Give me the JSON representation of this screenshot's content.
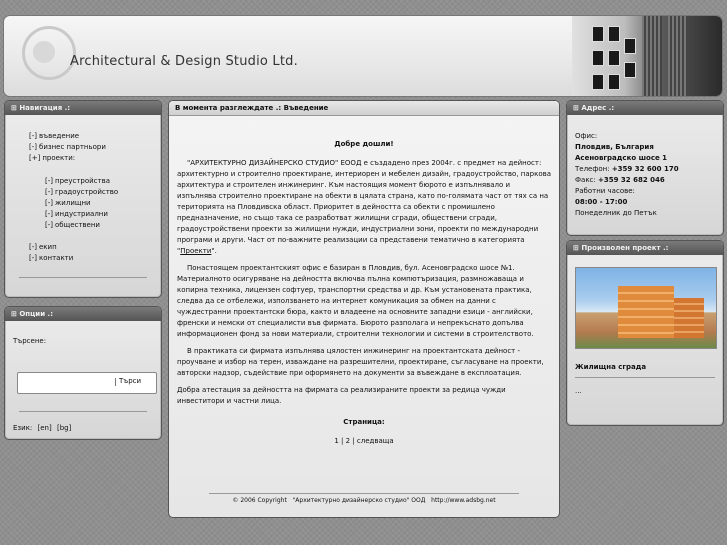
{
  "header": {
    "title": "Architectural & Design Studio Ltd."
  },
  "nav_panel": {
    "title": "Навигация .:",
    "items": [
      {
        "bullet": "[-]",
        "label": "въведение"
      },
      {
        "bullet": "[-]",
        "label": "бизнес партньори"
      },
      {
        "bullet": "[+]",
        "label": "проекти:"
      }
    ],
    "subitems": [
      {
        "bullet": "[-]",
        "label": "преустройства"
      },
      {
        "bullet": "[-]",
        "label": "градоустройство"
      },
      {
        "bullet": "[-]",
        "label": "жилищни"
      },
      {
        "bullet": "[-]",
        "label": "индустриални"
      },
      {
        "bullet": "[-]",
        "label": "обществени"
      }
    ],
    "items2": [
      {
        "bullet": "[-]",
        "label": "екип"
      },
      {
        "bullet": "[-]",
        "label": "контакти"
      }
    ]
  },
  "options_panel": {
    "title": "Опции .:",
    "search_label": "Търсене:",
    "search_value": "",
    "search_sep": "|",
    "search_button": "Търси",
    "lang_label": "Език:",
    "lang_en": "[en]",
    "lang_bg": "[bg]"
  },
  "center": {
    "breadcrumb": "В момента разглеждате .: Въведение",
    "welcome": "Добре дошли!",
    "p1": "\"АРХИТЕКТУРНО ДИЗАЙНЕРСКО СТУДИО\" ЕООД е създадено през 2004г. с предмет на дейност: архитектурно и строително проектиране, интериорен и мебелен дизайн, градоустройство, паркова архитектура и строителен инжинеринг. Към настоящия момент бюрото е изпълнявало и изпълнява строително проектиране на обекти в цялата страна, като по-голямата част от тях са на територията на Пловдивска област. Приоритет в дейността са обекти с промишлено предназначение, но също така се разработват жилищни сгради, обществени сгради, градоустройствени проекти за жилищни нужди, индустриални зони, проекти по международни програми и други. Част от по-важните реализации са представени тематично в категорията \"",
    "p1_link": "Проекти",
    "p1_end": "\".",
    "p2": "Понастоящем проектантският офис е базиран в Пловдив, бул. Асеновградско шосе №1. Материалното осигуряване на дейността включва пълна компютъризация, размножаваща и копирна техника, лицензен софтуер, транспортни средства и др. Към установената практика, следва да се отбележи, използването на интернет комуникация за обмен на данни с чуждестранни проектантски бюра, както и владеене на основните западни езици - английски, френски и немски от специалисти във фирмата. Бюрото разполага и непрекъснато допълва информационен фонд за нови материали, строителни технологии и системи в строителството.",
    "p3": "В практиката си фирмата изпълнява цялостен инжинеринг на проектантската дейност - проучване и избор на терен, изваждане на разрешителни, проектиране, съгласуване на проекти, авторски надзор, съдействие при оформянето на документи за въвеждане в експлоатация.",
    "p4": "Добра атестация за дейността на фирмата са реализираните проекти за редица чужди инвеститори и частни лица.",
    "page_label": "Страница:",
    "page_1": "1",
    "page_sep1": "|",
    "page_2": "2",
    "page_sep2": "|",
    "page_next": "следваща",
    "footer": "© 2006 Copyright   \"Архитектурно дизайнерско студио\" ООД   http://www.adsbg.net"
  },
  "address_panel": {
    "title": "Адрес .:",
    "line1": "Офис:",
    "line2": "Пловдив, България",
    "line3": "Асеновградско шосе 1",
    "line4_label": "Телефон:",
    "line4_value": "+359 32 600 170",
    "line5_label": "Факс:",
    "line5_value": "+359 32 682 046",
    "line6": "Работни часове:",
    "line7": "08:00 - 17:00",
    "line8": "Понеделник до Петък"
  },
  "project_panel": {
    "title": "Произволен проект .:",
    "caption": "Жилищна сграда",
    "more": "..."
  }
}
